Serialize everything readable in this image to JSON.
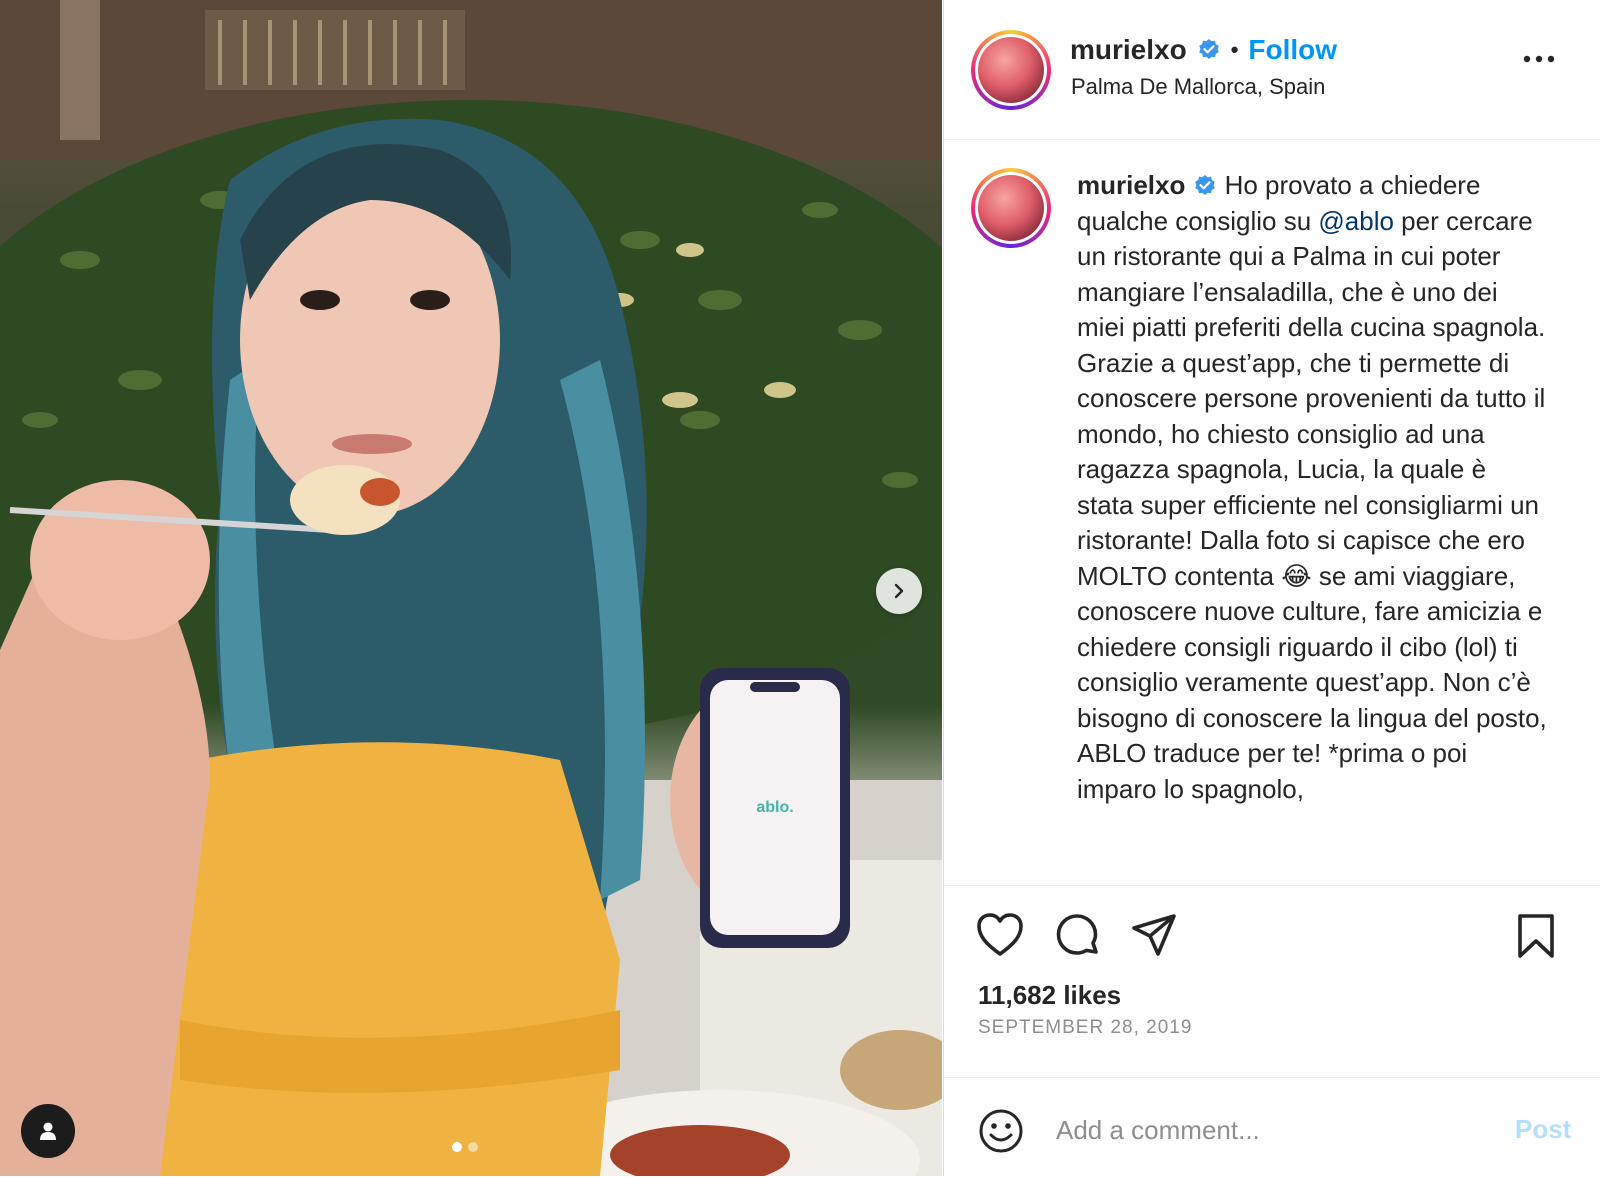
{
  "post": {
    "username": "murielxo",
    "follow_label": "Follow",
    "separator": "•",
    "location": "Palma De Mallorca, Spain",
    "caption_parts": {
      "before_mention": " Ho provato a chiedere qualche consiglio su ",
      "mention": "@ablo",
      "after_mention": " per cercare un ristorante qui a Palma in cui poter mangiare l’ensaladilla, che è uno dei miei piatti preferiti della cucina spagnola. Grazie a quest’app, che ti permette di conoscere persone provenienti da tutto il mondo, ho chiesto consiglio ad una ragazza spagnola, Lucia, la quale è stata super efficiente nel consigliarmi un ristorante! Dalla foto si capisce che ero MOLTO contenta 😂 se ami viaggiare, conoscere nuove culture, fare amicizia e chiedere consigli riguardo il cibo (lol) ti consiglio veramente quest’app. Non c’è bisogno di conoscere la lingua del posto, ABLO traduce per te! *prima o poi imparo lo spagnolo,"
    },
    "likes": "11,682 likes",
    "date": "SEPTEMBER 28, 2019"
  },
  "photo": {
    "phone_screen_text": "ablo.",
    "carousel_total": 2,
    "carousel_current": 1
  },
  "comment": {
    "placeholder": "Add a comment...",
    "post_label": "Post"
  },
  "icons": {
    "next": "chevron-right-icon",
    "tag": "user-tag-icon",
    "more": "more-options-icon",
    "like": "heart-icon",
    "comment": "comment-bubble-icon",
    "share": "paper-plane-icon",
    "save": "bookmark-icon",
    "emoji": "smiley-icon",
    "verified": "verified-badge-icon"
  },
  "colors": {
    "accent": "#0095f6",
    "verified": "#3897f0",
    "mention": "#00376b",
    "post_disabled": "#b2dffc",
    "muted": "#8e8e8e"
  }
}
